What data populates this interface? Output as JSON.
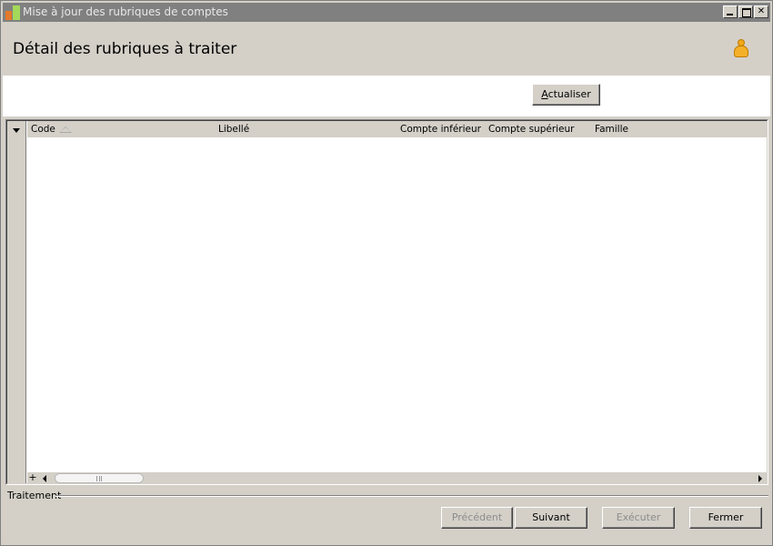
{
  "window": {
    "title": "Mise à jour des rubriques de comptes"
  },
  "header": {
    "title": "Détail des rubriques à traiter",
    "user_icon": "user-icon"
  },
  "toolbar": {
    "refresh_label_accel": "A",
    "refresh_label_rest": "ctualiser"
  },
  "grid": {
    "columns": [
      {
        "label": "Code",
        "sorted": "ascending"
      },
      {
        "label": "Libellé"
      },
      {
        "label": "Compte inférieur"
      },
      {
        "label": "Compte supérieur"
      },
      {
        "label": "Famille"
      }
    ],
    "rows": [],
    "add_row_label": "+"
  },
  "footer": {
    "group_label": "Traitement",
    "prev_label": "Précédent",
    "next_label": "Suivant",
    "exec_label": "Exécuter",
    "close_label": "Fermer"
  },
  "colors": {
    "window_bg": "#d4d0c8",
    "titlebar_bg": "#808080",
    "disabled_text": "#8c8c8c",
    "user_icon": "#f2a818"
  }
}
